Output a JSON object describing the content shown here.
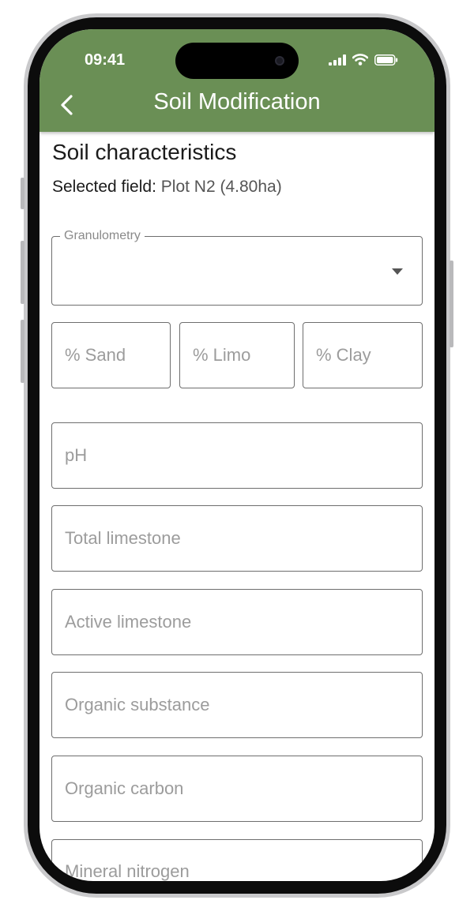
{
  "status_bar": {
    "time": "09:41"
  },
  "header": {
    "title": "Soil Modification"
  },
  "section": {
    "title": "Soil characteristics",
    "selected_label": "Selected field:",
    "selected_value": "Plot N2 (4.80ha)"
  },
  "granulometry": {
    "label": "Granulometry",
    "value": ""
  },
  "percent_fields": {
    "sand": "% Sand",
    "limo": "% Limo",
    "clay": "% Clay"
  },
  "fields": {
    "ph": "pH",
    "total_limestone": "Total limestone",
    "active_limestone": "Active limestone",
    "organic_substance": "Organic substance",
    "organic_carbon": "Organic carbon",
    "mineral_nitrogen": "Mineral nitrogen"
  },
  "colors": {
    "header": "#6a8f55",
    "frame": "#c9c9cb"
  }
}
